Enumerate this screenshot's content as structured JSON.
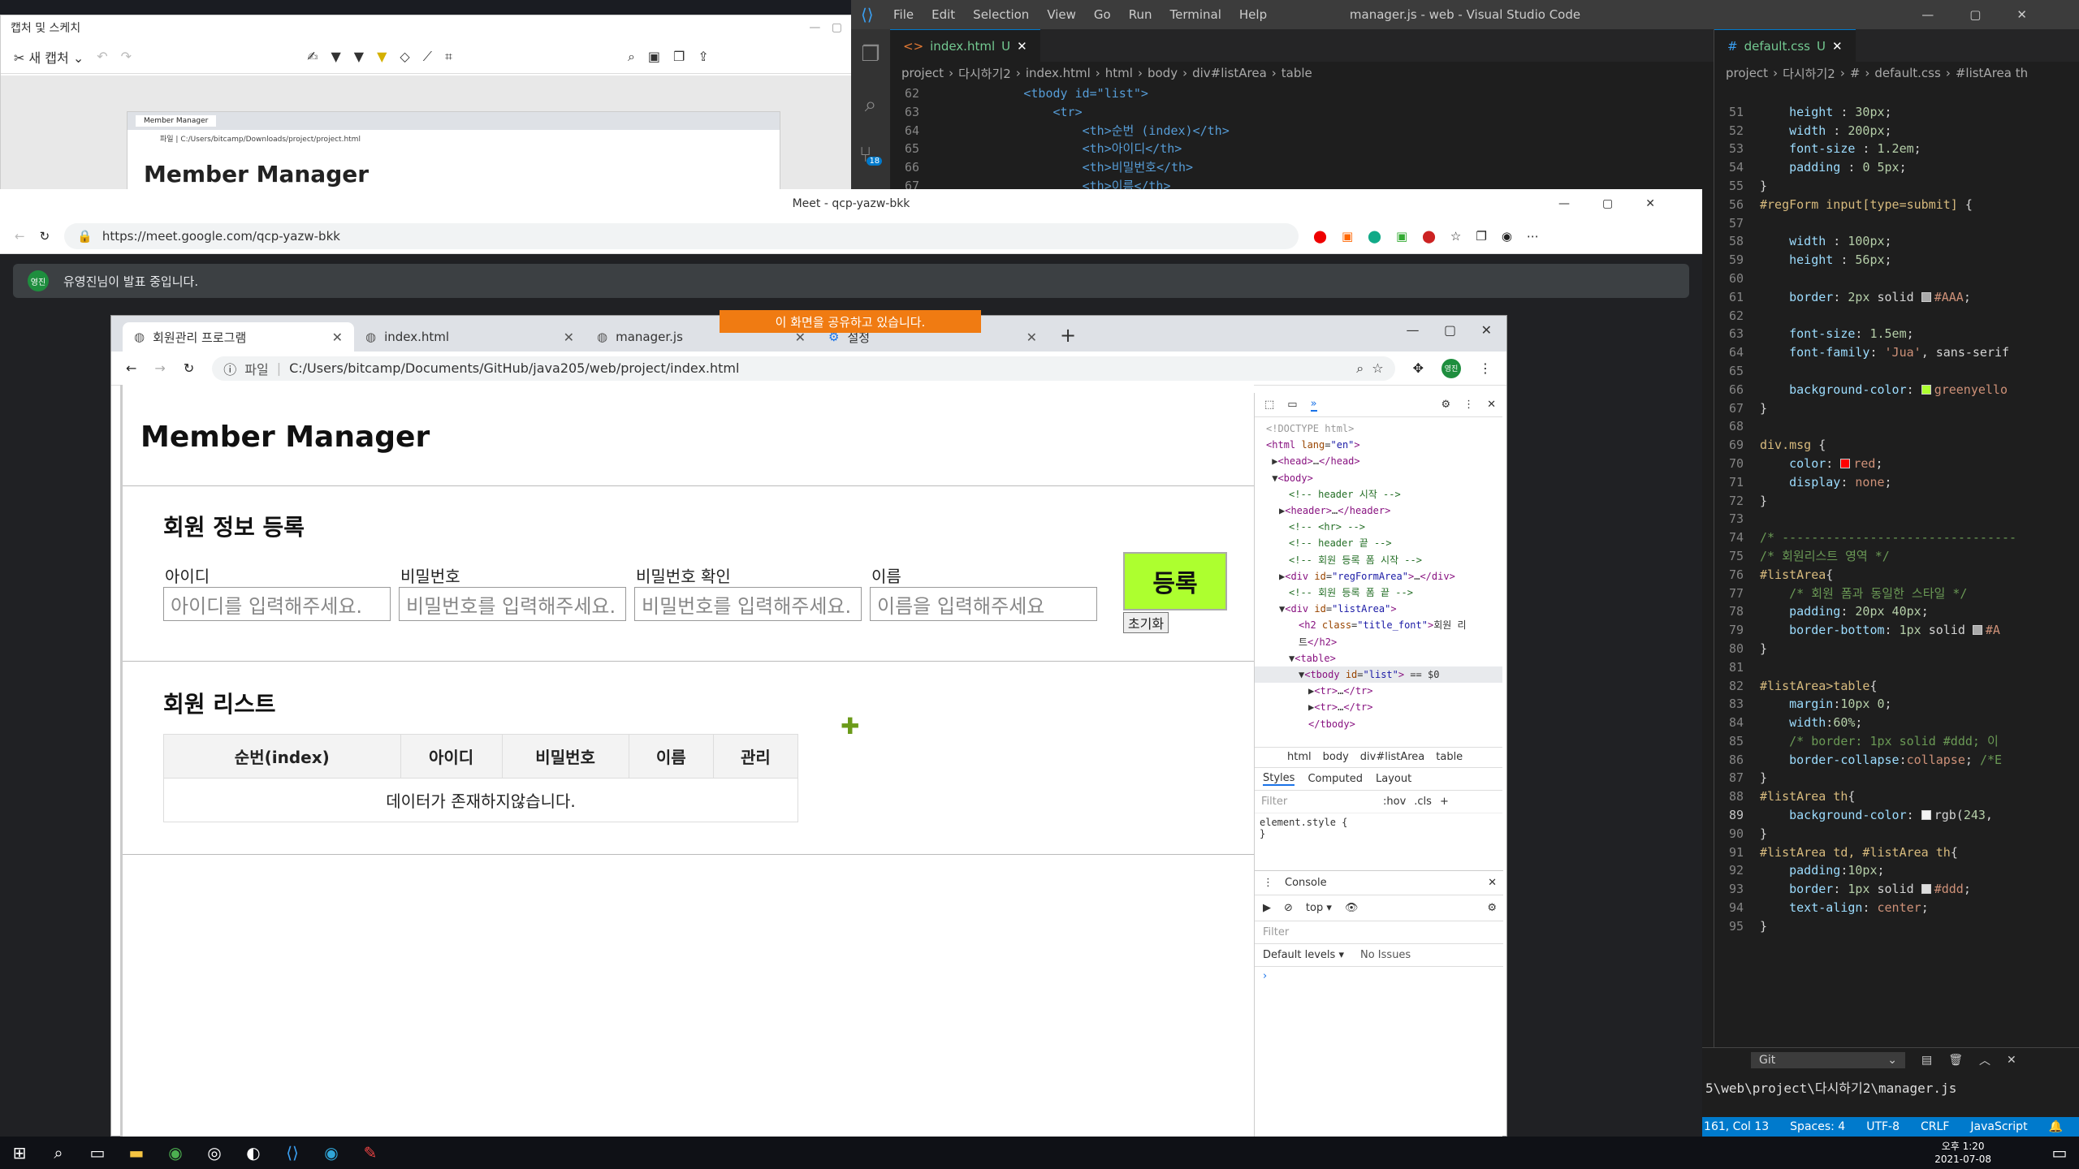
{
  "snip": {
    "title": "캡처 및 스케치",
    "new_capture": "새 캡처",
    "mini_tab": "Member Manager",
    "mini_url": "파일 | C:/Users/bitcamp/Downloads/project/project.html",
    "mini_heading": "Member Manager"
  },
  "vscode": {
    "window_title": "manager.js - web - Visual Studio Code",
    "menu": [
      "File",
      "Edit",
      "Selection",
      "View",
      "Go",
      "Run",
      "Terminal",
      "Help"
    ],
    "scm_badge": "18",
    "left_tab": "index.html",
    "left_tab_status": "U",
    "left_breadcrumb": [
      "project",
      "다시하기2",
      "index.html",
      "html",
      "body",
      "div#listArea",
      "table"
    ],
    "left_lines": [
      {
        "n": "62",
        "code": "            <tbody id=\"list\">"
      },
      {
        "n": "63",
        "code": "                <tr>"
      },
      {
        "n": "64",
        "code": "                    <th>순번 (index)</th>"
      },
      {
        "n": "65",
        "code": "                    <th>아이디</th>"
      },
      {
        "n": "66",
        "code": "                    <th>비밀번호</th>"
      },
      {
        "n": "67",
        "code": "                    <th>이름</th>"
      }
    ],
    "right_tab": "default.css",
    "right_tab_status": "U",
    "right_breadcrumb": [
      "project",
      "다시하기2",
      "#",
      "default.css",
      "#listArea th"
    ],
    "status": {
      "pos": "Ln 161, Col 13",
      "spaces": "Spaces: 4",
      "enc": "UTF-8",
      "eol": "CRLF",
      "lang": "JavaScript"
    },
    "terminal_select": "Git",
    "terminal_path": "5\\web\\project\\다시하기2\\manager.js"
  },
  "meet": {
    "window_title": "Meet - qcp-yazw-bkk",
    "url": "https://meet.google.com/qcp-yazw-bkk",
    "presenter_avatar": "영진",
    "presenter_text": "유영진님이 발표 중입니다."
  },
  "shared": {
    "sharing_banner": "이 화면을 공유하고 있습니다.",
    "tabs": [
      {
        "label": "회원관리 프로그램",
        "active": true
      },
      {
        "label": "index.html",
        "active": false
      },
      {
        "label": "manager.js",
        "active": false
      },
      {
        "label": "설정",
        "active": false
      }
    ],
    "url_prefix": "파일",
    "url": "C:/Users/bitcamp/Documents/GitHub/java205/web/project/index.html",
    "profile": "영진"
  },
  "page": {
    "brand": "Member Manager",
    "reg_title": "회원 정보 등록",
    "fields": [
      {
        "label": "아이디",
        "placeholder": "아이디를 입력해주세요."
      },
      {
        "label": "비밀번호",
        "placeholder": "비밀번호를 입력해주세요."
      },
      {
        "label": "비밀번호 확인",
        "placeholder": "비밀번호를 입력해주세요."
      },
      {
        "label": "이름",
        "placeholder": "이름을 입력해주세요"
      }
    ],
    "submit": "등록",
    "reset": "초기화",
    "list_title": "회원 리스트",
    "columns": [
      "순번(index)",
      "아이디",
      "비밀번호",
      "이름",
      "관리"
    ],
    "empty": "데이터가 존재하지않습니다."
  },
  "devtools": {
    "crumbs": [
      "html",
      "body",
      "div#listArea",
      "table"
    ],
    "style_tabs": [
      "Styles",
      "Computed",
      "Layout"
    ],
    "filter": "Filter",
    "hov": ":hov",
    "cls": ".cls",
    "element_style": "element.style {",
    "element_style_close": "}",
    "console_title": "Console",
    "console_context": "top",
    "console_filter": "Filter",
    "levels": "Default levels",
    "issues": "No Issues"
  },
  "taskbar": {
    "time": "오후 1:20",
    "date": "2021-07-08"
  },
  "colors": {
    "greenyellow": "#adff2f",
    "vscode_status": "#007acc",
    "sharing": "#f07b12"
  }
}
